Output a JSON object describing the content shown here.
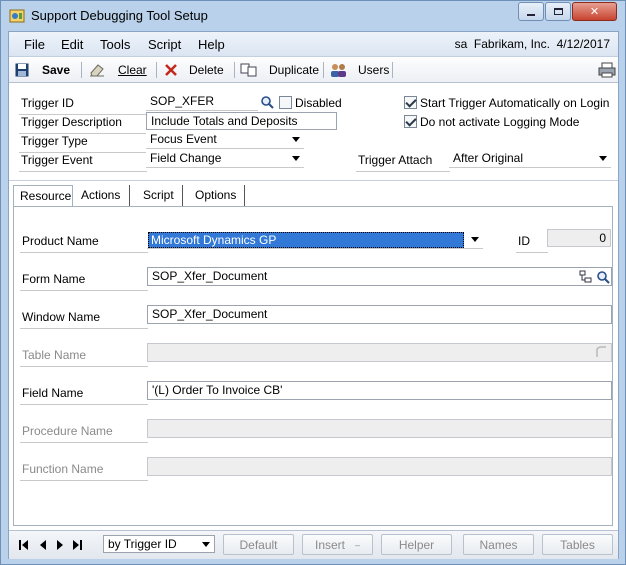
{
  "window": {
    "title": "Support Debugging Tool Setup",
    "minimize": "▭",
    "maximize": "▢",
    "close": "✕"
  },
  "menu": {
    "items": [
      "File",
      "Edit",
      "Tools",
      "Script",
      "Help"
    ],
    "status": "sa  Fabrikam, Inc.  4/12/2017"
  },
  "toolbar": {
    "save": "Save",
    "clear": "Clear",
    "delete": "Delete",
    "duplicate": "Duplicate",
    "users": "Users"
  },
  "header": {
    "trigger_id_label": "Trigger ID",
    "trigger_id_value": "SOP_XFER",
    "disabled_label": "Disabled",
    "trigger_description_label": "Trigger Description",
    "trigger_description_value": "Include Totals and Deposits",
    "trigger_type_label": "Trigger Type",
    "trigger_type_value": "Focus Event",
    "trigger_event_label": "Trigger Event",
    "trigger_event_value": "Field Change",
    "start_auto_label": "Start Trigger Automatically on Login",
    "no_logging_label": "Do not activate Logging Mode",
    "trigger_attach_label": "Trigger Attach",
    "trigger_attach_value": "After Original"
  },
  "tabs": [
    "Resource",
    "Actions",
    "Script",
    "Options"
  ],
  "resource": {
    "product_name_label": "Product Name",
    "product_name_value": "Microsoft Dynamics GP",
    "id_label": "ID",
    "id_value": "0",
    "form_name_label": "Form Name",
    "form_name_value": "SOP_Xfer_Document",
    "window_name_label": "Window Name",
    "window_name_value": "SOP_Xfer_Document",
    "table_name_label": "Table Name",
    "field_name_label": "Field Name",
    "field_name_value": "'(L) Order To Invoice CB'",
    "procedure_name_label": "Procedure Name",
    "function_name_label": "Function Name"
  },
  "statusbar": {
    "sort_value": "by Trigger ID",
    "buttons": [
      "Default",
      "Insert",
      "Helper",
      "Names",
      "Tables"
    ]
  }
}
